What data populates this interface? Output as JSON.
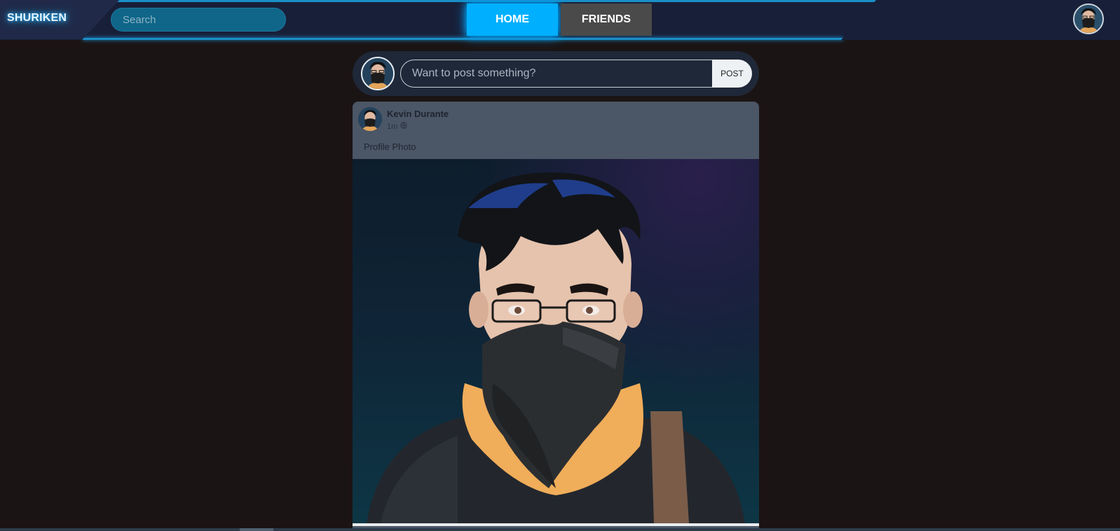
{
  "app": {
    "brand": "SHURIKEN"
  },
  "header": {
    "search_placeholder": "Search",
    "nav": [
      {
        "label": "HOME",
        "active": true
      },
      {
        "label": "FRIENDS",
        "active": false
      }
    ]
  },
  "composer": {
    "placeholder": "Want to post something?",
    "post_label": "POST"
  },
  "post": {
    "author": "Kevin Durante",
    "time": "1m",
    "visibility_icon": "globe-icon",
    "caption": "Profile Photo"
  },
  "colors": {
    "accent": "#00b0ff",
    "header_bg": "#181f38",
    "page_bg": "#1b1414",
    "card_bg": "#4b5666"
  }
}
